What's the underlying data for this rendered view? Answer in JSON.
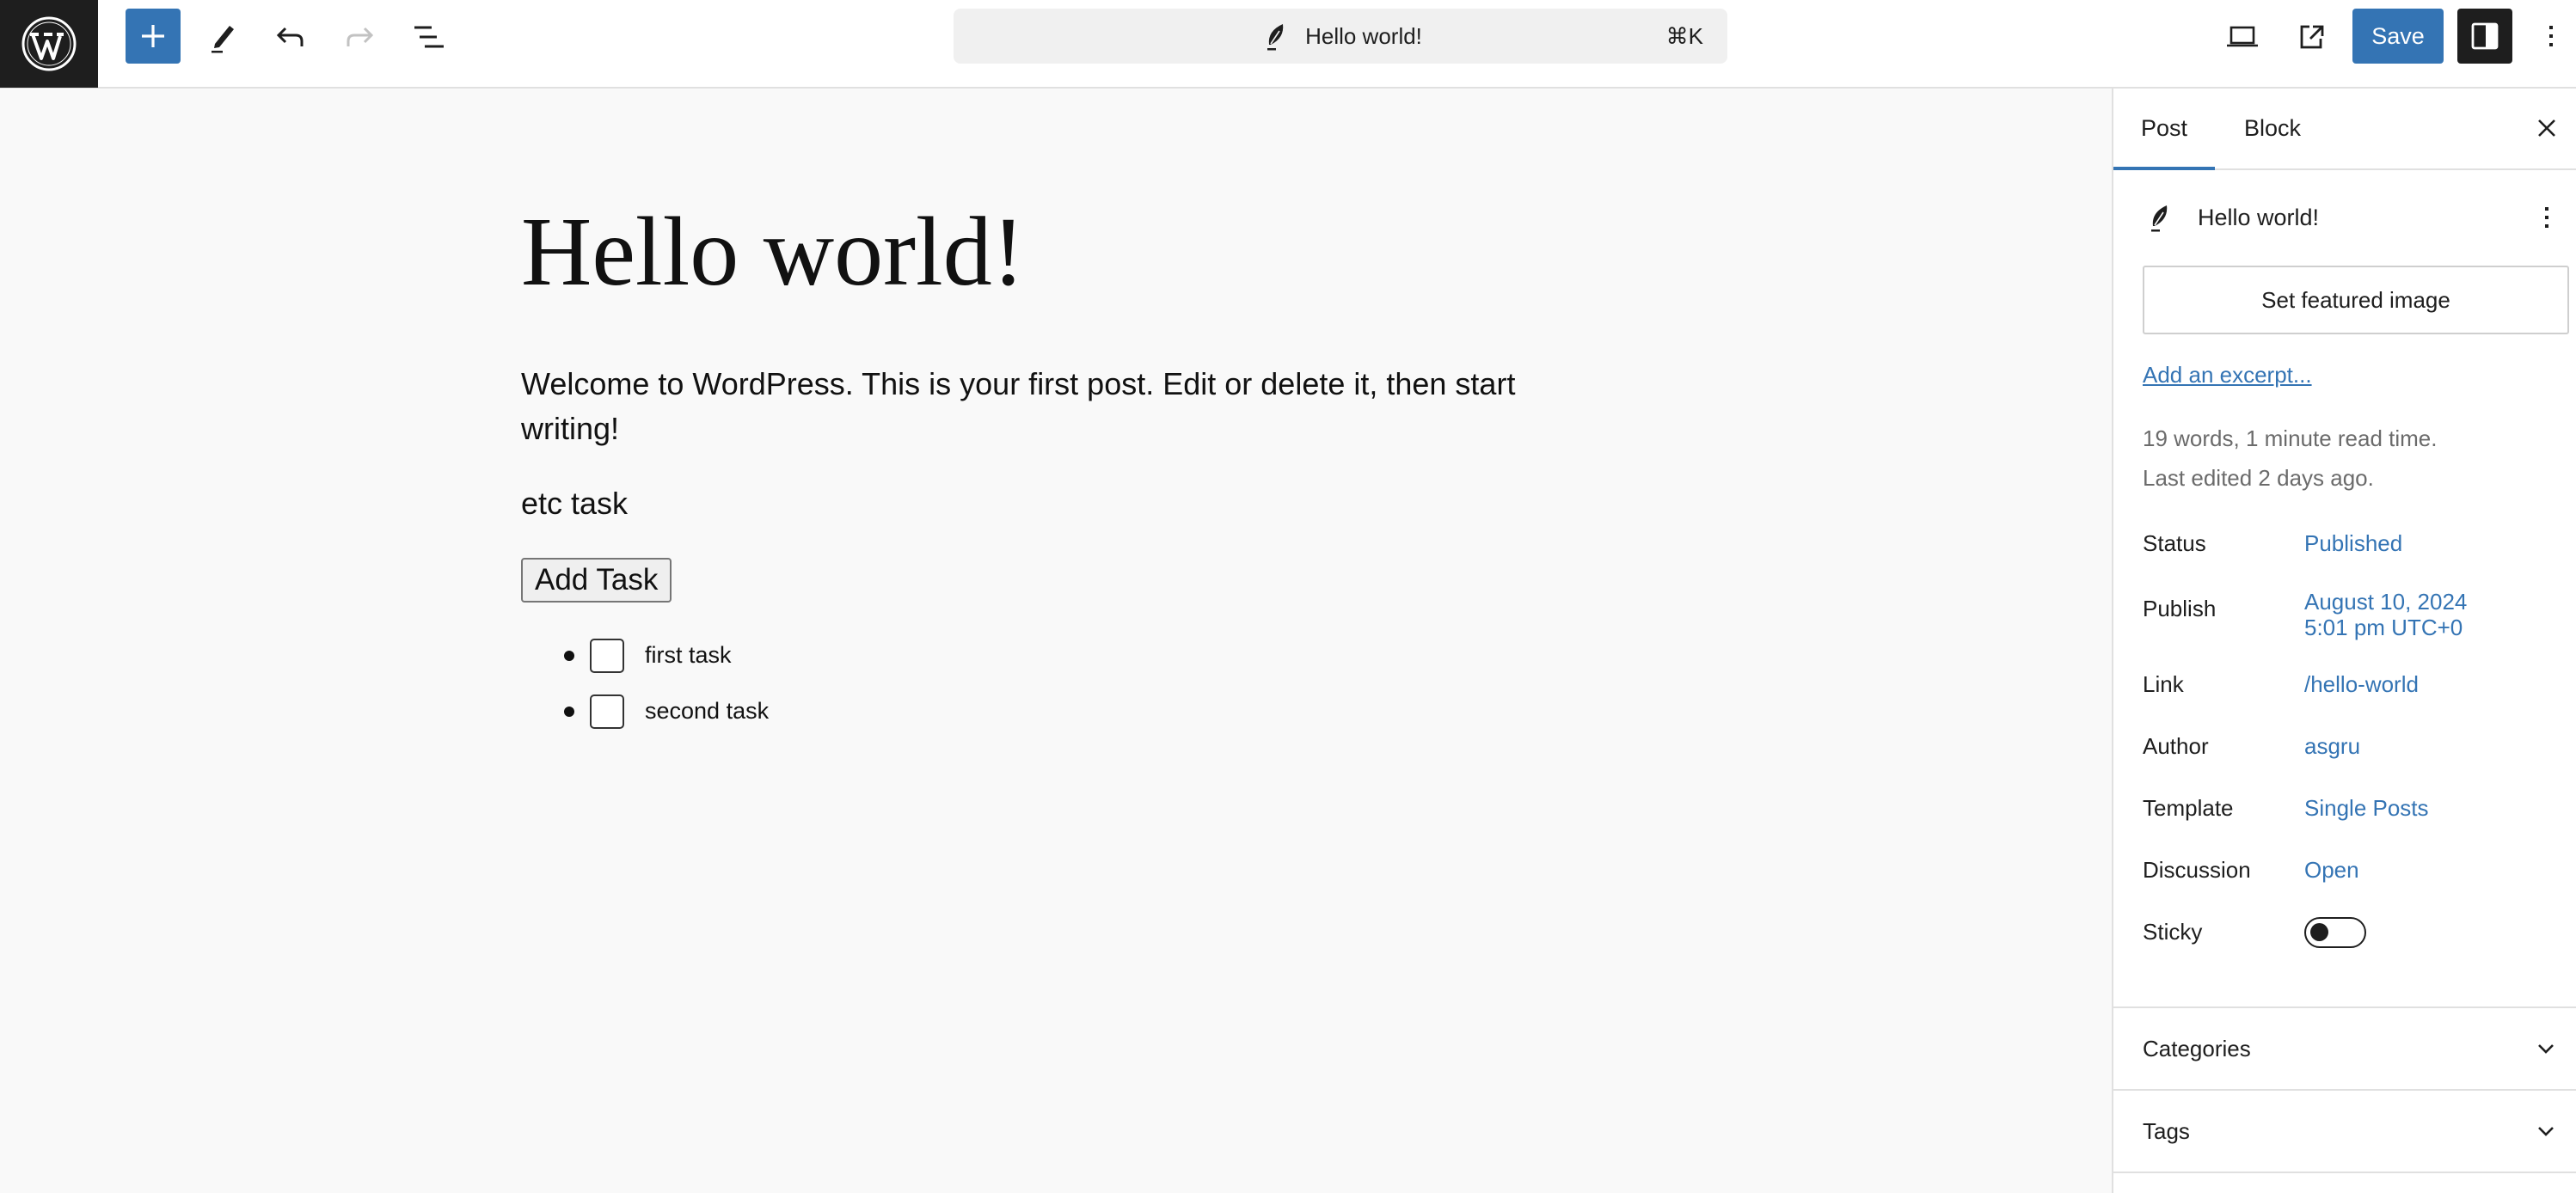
{
  "header": {
    "logo": "wordpress-logo-icon",
    "toolbar": {
      "inserter": "plus-icon",
      "tools": "pencil-icon",
      "undo": "undo-icon",
      "redo": "redo-icon",
      "list_view": "list-view-icon"
    },
    "command_bar": {
      "icon": "post-feather-icon",
      "title": "Hello world!",
      "shortcut": "⌘K"
    },
    "right": {
      "preview": "laptop-icon",
      "view_post": "external-link-icon",
      "save_label": "Save",
      "settings": "sidebar-toggle-icon",
      "options": "kebab-menu-icon"
    },
    "colors": {
      "accent": "#3474b4",
      "dark": "#1e1e1e"
    }
  },
  "editor": {
    "title": "Hello world!",
    "paragraphs": [
      "Welcome to WordPress. This is your first post. Edit or delete it, then start writing!",
      "etc task"
    ],
    "add_task_label": "Add Task",
    "tasks": [
      {
        "label": "first task",
        "checked": false
      },
      {
        "label": "second task",
        "checked": false
      }
    ]
  },
  "sidebar": {
    "tabs": [
      {
        "label": "Post",
        "active": true
      },
      {
        "label": "Block",
        "active": false
      }
    ],
    "post": {
      "title": "Hello world!",
      "featured_image_label": "Set featured image",
      "excerpt_link": "Add an excerpt...",
      "stats_words": "19 words, 1 minute read time.",
      "stats_edited": "Last edited 2 days ago."
    },
    "meta": {
      "status": {
        "label": "Status",
        "value": "Published"
      },
      "publish": {
        "label": "Publish",
        "value_line1": "August 10, 2024",
        "value_line2": "5:01 pm UTC+0"
      },
      "link": {
        "label": "Link",
        "value": "/hello-world"
      },
      "author": {
        "label": "Author",
        "value": "asgru"
      },
      "template": {
        "label": "Template",
        "value": "Single Posts"
      },
      "discussion": {
        "label": "Discussion",
        "value": "Open"
      },
      "sticky": {
        "label": "Sticky",
        "enabled": false
      }
    },
    "panels": [
      {
        "title": "Categories",
        "expanded": false
      },
      {
        "title": "Tags",
        "expanded": false
      }
    ]
  }
}
